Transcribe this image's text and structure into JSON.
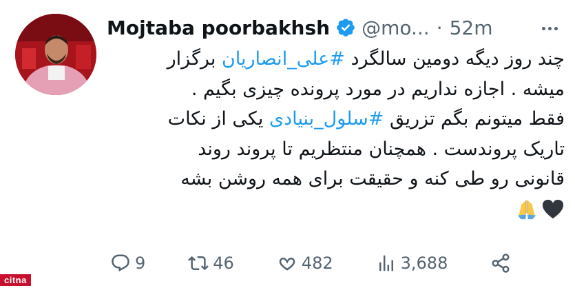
{
  "tweet": {
    "author_name": "Mojtaba poorbakhsh",
    "handle": "@mo...",
    "separator": "·",
    "time": "52m",
    "lines": [
      [
        "چند روز دیگه دومین سالگرد ",
        "#علی_انصاریان",
        " برگزار"
      ],
      [
        "میشه . اجازه نداریم در مورد پرونده چیزی بگیم ."
      ],
      [
        "فقط میتونم بگم تزریق ",
        "#سلول_بنیادی",
        " یکی از نکات"
      ],
      [
        "تاریک پروندست . همچنان منتظریم تا پروند روند"
      ],
      [
        "قانونی رو طی کنه و حقیقت برای همه روشن بشه"
      ]
    ],
    "emojis": [
      "praying-hands-emoji",
      "black-heart-emoji"
    ]
  },
  "actions": {
    "replies": "9",
    "retweets": "46",
    "likes": "482",
    "views": "3,688"
  },
  "watermark": "citna",
  "colors": {
    "text": "#0f1419",
    "secondary": "#536471",
    "link": "#1d9bf0",
    "verified": "#1d9bf0",
    "watermark_bg": "#c8102e"
  }
}
